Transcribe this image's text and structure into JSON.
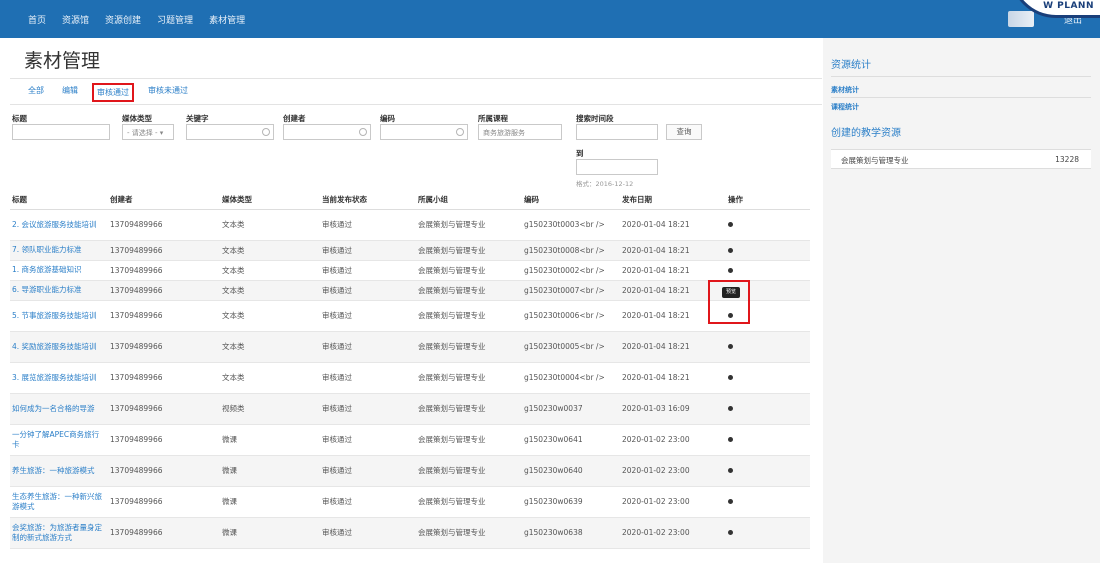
{
  "topnav": [
    "首页",
    "资源馆",
    "资源创建",
    "习题管理",
    "素材管理"
  ],
  "logo_text": "W PLANN",
  "logout": "退出",
  "page_title": "素材管理",
  "tabs": [
    {
      "label": "全部",
      "active": false
    },
    {
      "label": "编辑",
      "active": false
    },
    {
      "label": "审核通过",
      "active": true
    },
    {
      "label": "审核未通过",
      "active": false
    }
  ],
  "filters": {
    "title_label": "标题",
    "media_type_label": "媒体类型",
    "media_type_value": "- 请选择 -",
    "keyword_label": "关键字",
    "creator_label": "创建者",
    "code_label": "编码",
    "course_label": "所属课程",
    "course_value": "商务旅游服务",
    "search_time_label": "搜索时间段",
    "search_button": "查询",
    "to_label": "到",
    "format_hint": "格式：2016-12-12"
  },
  "table": {
    "headers": [
      "标题",
      "创建者",
      "媒体类型",
      "当前发布状态",
      "所属小组",
      "编码",
      "发布日期",
      "操作"
    ],
    "rows": [
      {
        "title": "2. 会议旅游服务技能培训",
        "creator": "13709489966",
        "type": "文本类",
        "status": "审核通过",
        "group": "会展策划与管理专业",
        "code": "g150230t0003<br />",
        "date": "2020-01-04 18:21",
        "tall": true
      },
      {
        "title": "7. 领队职业能力标准",
        "creator": "13709489966",
        "type": "文本类",
        "status": "审核通过",
        "group": "会展策划与管理专业",
        "code": "g150230t0008<br />",
        "date": "2020-01-04 18:21",
        "tall": false
      },
      {
        "title": "1. 商务旅游基础知识",
        "creator": "13709489966",
        "type": "文本类",
        "status": "审核通过",
        "group": "会展策划与管理专业",
        "code": "g150230t0002<br />",
        "date": "2020-01-04 18:21",
        "tall": false
      },
      {
        "title": "6. 导游职业能力标准",
        "creator": "13709489966",
        "type": "文本类",
        "status": "审核通过",
        "group": "会展策划与管理专业",
        "code": "g150230t0007<br />",
        "date": "2020-01-04 18:21",
        "tall": false
      },
      {
        "title": "5. 节事旅游服务技能培训",
        "creator": "13709489966",
        "type": "文本类",
        "status": "审核通过",
        "group": "会展策划与管理专业",
        "code": "g150230t0006<br />",
        "date": "2020-01-04 18:21",
        "tall": true
      },
      {
        "title": "4. 奖励旅游服务技能培训",
        "creator": "13709489966",
        "type": "文本类",
        "status": "审核通过",
        "group": "会展策划与管理专业",
        "code": "g150230t0005<br />",
        "date": "2020-01-04 18:21",
        "tall": true
      },
      {
        "title": "3. 展览旅游服务技能培训",
        "creator": "13709489966",
        "type": "文本类",
        "status": "审核通过",
        "group": "会展策划与管理专业",
        "code": "g150230t0004<br />",
        "date": "2020-01-04 18:21",
        "tall": true
      },
      {
        "title": "如何成为一名合格的导游",
        "creator": "13709489966",
        "type": "视频类",
        "status": "审核通过",
        "group": "会展策划与管理专业",
        "code": "g150230w0037",
        "date": "2020-01-03 16:09",
        "tall": true
      },
      {
        "title": "一分钟了解APEC商务旅行卡",
        "creator": "13709489966",
        "type": "微课",
        "status": "审核通过",
        "group": "会展策划与管理专业",
        "code": "g150230w0641",
        "date": "2020-01-02 23:00",
        "tall": true
      },
      {
        "title": "养生旅游：一种旅游模式",
        "creator": "13709489966",
        "type": "微课",
        "status": "审核通过",
        "group": "会展策划与管理专业",
        "code": "g150230w0640",
        "date": "2020-01-02 23:00",
        "tall": true
      },
      {
        "title": "生态养生旅游：一种新兴旅游模式",
        "creator": "13709489966",
        "type": "微课",
        "status": "审核通过",
        "group": "会展策划与管理专业",
        "code": "g150230w0639",
        "date": "2020-01-02 23:00",
        "tall": true
      },
      {
        "title": "会奖旅游：为旅游者量身定制的新式旅游方式",
        "creator": "13709489966",
        "type": "微课",
        "status": "审核通过",
        "group": "会展策划与管理专业",
        "code": "g150230w0638",
        "date": "2020-01-02 23:00",
        "tall": true
      }
    ]
  },
  "tooltip": "预览",
  "sidebar": {
    "stats_title": "资源统计",
    "material_stats": "素材统计",
    "course_stats": "课程统计",
    "created_title": "创建的教学资源",
    "created_rows": [
      {
        "name": "会展策划与管理专业",
        "count": "13228"
      }
    ]
  }
}
